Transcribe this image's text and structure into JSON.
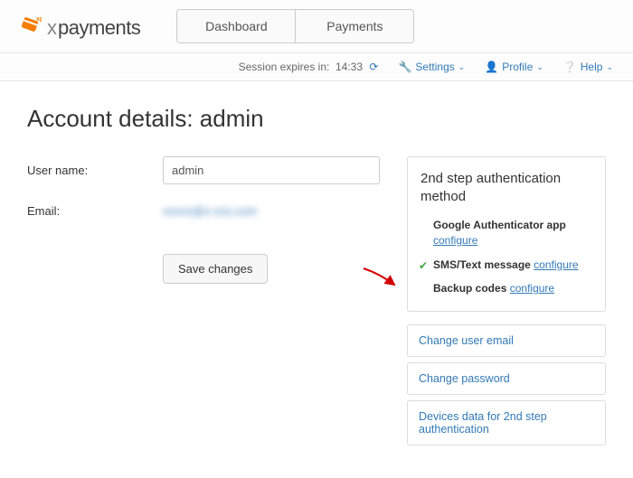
{
  "logo": {
    "x": "x",
    "pay": "payments"
  },
  "tabs": {
    "dashboard": "Dashboard",
    "payments": "Payments"
  },
  "util": {
    "session_label": "Session expires in:",
    "session_time": "14:33",
    "settings": "Settings",
    "profile": "Profile",
    "help": "Help"
  },
  "title": "Account details: admin",
  "form": {
    "username_label": "User name:",
    "username_value": "admin",
    "email_label": "Email:",
    "email_value": "xxxxx@x-xxx.com"
  },
  "auth": {
    "heading": "2nd step authentication method",
    "google": "Google Authenticator app",
    "sms": "SMS/Text message",
    "backup": "Backup codes",
    "configure": "configure"
  },
  "actions": {
    "change_email": "Change user email",
    "change_password": "Change password",
    "devices": "Devices data for 2nd step authentication"
  },
  "save": "Save changes"
}
